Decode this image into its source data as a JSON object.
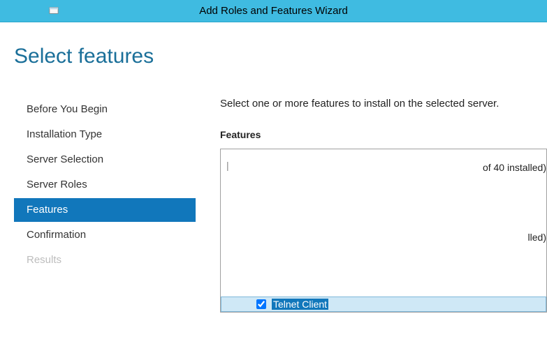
{
  "window": {
    "title": "Add Roles and Features Wizard"
  },
  "page": {
    "title": "Select features"
  },
  "sidebar": {
    "items": [
      {
        "label": "Before You Begin",
        "state": "normal"
      },
      {
        "label": "Installation Type",
        "state": "normal"
      },
      {
        "label": "Server Selection",
        "state": "normal"
      },
      {
        "label": "Server Roles",
        "state": "normal"
      },
      {
        "label": "Features",
        "state": "active"
      },
      {
        "label": "Confirmation",
        "state": "normal"
      },
      {
        "label": "Results",
        "state": "disabled"
      }
    ]
  },
  "main": {
    "instruction": "Select one or more features to install on the selected server.",
    "features_label": "Features",
    "count_fragment": "of 40 installed)",
    "installed_fragment": "lled)",
    "selected_feature": {
      "label": "Telnet Client",
      "checked": true
    }
  }
}
